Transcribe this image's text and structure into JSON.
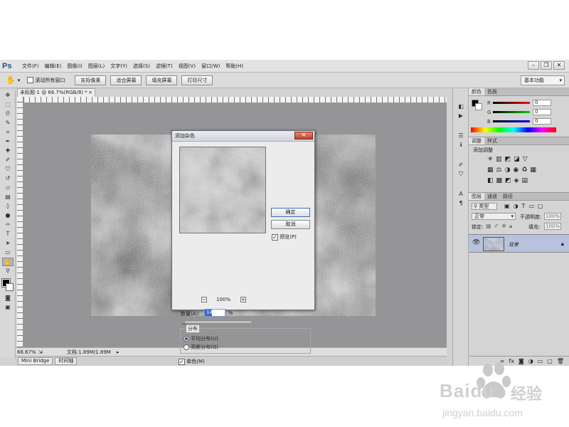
{
  "app": {
    "logo": "Ps",
    "menu": [
      "文件(F)",
      "编辑(E)",
      "图像(I)",
      "图层(L)",
      "文字(Y)",
      "选择(S)",
      "滤镜(T)",
      "视图(V)",
      "窗口(W)",
      "帮助(H)"
    ]
  },
  "options_bar": {
    "scroll_all_windows_label": "滚动所有窗口",
    "buttons": [
      "实际像素",
      "适合屏幕",
      "填充屏幕",
      "打印尺寸"
    ],
    "workspace": "基本功能"
  },
  "document": {
    "tab_title": "未标题-1 @ 66.7%(RGB/8) *",
    "zoom": "66.67%",
    "doc_size": "文档:1.89M/1.89M"
  },
  "bottom_tabs": [
    "Mini Bridge",
    "时间轴"
  ],
  "color_panel": {
    "tabs": [
      "颜色",
      "色板"
    ],
    "sliders": [
      {
        "channel": "R",
        "value": "0"
      },
      {
        "channel": "G",
        "value": "0"
      },
      {
        "channel": "B",
        "value": "0"
      }
    ]
  },
  "adjustments_panel": {
    "tabs": [
      "调整",
      "样式"
    ],
    "subtitle": "添加调整"
  },
  "layers_panel": {
    "tabs": [
      "图层",
      "通道",
      "路径"
    ],
    "filter": "类型",
    "blend_mode": "正常",
    "opacity_label": "不透明度:",
    "opacity_value": "100%",
    "lock_label": "锁定:",
    "fill_label": "填充:",
    "fill_value": "100%",
    "layers": [
      {
        "name": "背景"
      }
    ]
  },
  "dialog": {
    "title": "添加杂色",
    "ok": "确定",
    "cancel": "取消",
    "preview_label": "预览(P)",
    "zoom": "100%",
    "amount_label": "数量(A):",
    "amount_value": "14",
    "amount_unit": "%",
    "distribution_title": "分布",
    "uniform_label": "平均分布(U)",
    "gaussian_label": "高斯分布(G)",
    "monochrome_label": "单色(M)"
  },
  "watermark": {
    "brand": "Baidu",
    "brand_cn": "经验",
    "url": "jingyan.baidu.com"
  },
  "colors": {
    "accent": "#2b5aa8",
    "canvas_bg": "#959598",
    "layer_selected": "#b7c3de"
  }
}
